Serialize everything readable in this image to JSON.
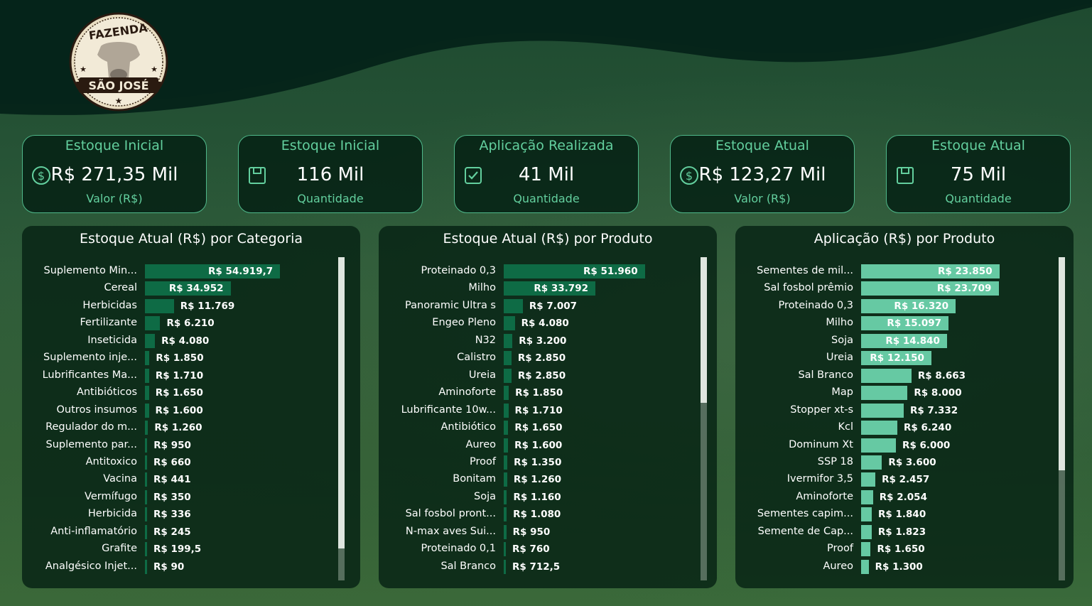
{
  "brand": {
    "logo_top": "FAZENDA",
    "logo_bottom": "SÃO JOSÉ"
  },
  "colors": {
    "bar_dark": "#0e6b45",
    "bar_light": "#66c9a3",
    "accent": "#63cf9e"
  },
  "kpis": [
    {
      "title": "Estoque Inicial",
      "value": "R$ 271,35 Mil",
      "subtitle": "Valor (R$)",
      "icon": "dollar-circle-icon"
    },
    {
      "title": "Estoque Inicial",
      "value": "116 Mil",
      "subtitle": "Quantidade",
      "icon": "save-box-icon"
    },
    {
      "title": "Aplicação Realizada",
      "value": "41 Mil",
      "subtitle": "Quantidade",
      "icon": "check-square-icon"
    },
    {
      "title": "Estoque Atual",
      "value": "R$ 123,27 Mil",
      "subtitle": "Valor (R$)",
      "icon": "dollar-circle-icon"
    },
    {
      "title": "Estoque Atual",
      "value": "75 Mil",
      "subtitle": "Quantidade",
      "icon": "save-box-icon"
    }
  ],
  "chart_data": [
    {
      "type": "bar",
      "orientation": "horizontal",
      "title": "Estoque Atual (R$) por Categoria",
      "color": "#0e6b45",
      "categories": [
        "Suplemento Min...",
        "Cereal",
        "Herbicidas",
        "Fertilizante",
        "Inseticida",
        "Suplemento inje...",
        "Lubrificantes Ma...",
        "Antibióticos",
        "Outros insumos",
        "Regulador do m...",
        "Suplemento par...",
        "Antitoxico",
        "Vacina",
        "Vermífugo",
        "Herbicida",
        "Anti-inflamatório",
        "Grafite",
        "Analgésico Injet..."
      ],
      "values": [
        54919.7,
        34952,
        11769,
        6210,
        4080,
        1850,
        1710,
        1650,
        1600,
        1260,
        950,
        660,
        441,
        350,
        336,
        245,
        199.5,
        90
      ],
      "labels": [
        "R$ 54.919,7",
        "R$ 34.952",
        "R$ 11.769",
        "R$ 6.210",
        "R$ 4.080",
        "R$ 1.850",
        "R$ 1.710",
        "R$ 1.650",
        "R$ 1.600",
        "R$ 1.260",
        "R$ 950",
        "R$ 660",
        "R$ 441",
        "R$ 350",
        "R$ 336",
        "R$ 245",
        "R$ 199,5",
        "R$ 90"
      ],
      "scroll_fraction": 0.9
    },
    {
      "type": "bar",
      "orientation": "horizontal",
      "title": "Estoque Atual (R$) por Produto",
      "color": "#0e6b45",
      "categories": [
        "Proteinado 0,3",
        "Milho",
        "Panoramic Ultra s",
        "Engeo Pleno",
        "N32",
        "Calistro",
        "Ureia",
        "Aminoforte",
        "Lubrificante 10w...",
        "Antibiótico",
        "Aureo",
        "Proof",
        "Bonitam",
        "Soja",
        "Sal fosbol pront...",
        "N-max aves Sui...",
        "Proteinado 0,1",
        "Sal Branco"
      ],
      "values": [
        51960,
        33792,
        7007,
        4080,
        3200,
        2850,
        2850,
        1850,
        1710,
        1650,
        1600,
        1350,
        1260,
        1160,
        1080,
        950,
        760,
        712.5
      ],
      "labels": [
        "R$ 51.960",
        "R$ 33.792",
        "R$ 7.007",
        "R$ 4.080",
        "R$ 3.200",
        "R$ 2.850",
        "R$ 2.850",
        "R$ 1.850",
        "R$ 1.710",
        "R$ 1.650",
        "R$ 1.600",
        "R$ 1.350",
        "R$ 1.260",
        "R$ 1.160",
        "R$ 1.080",
        "R$ 950",
        "R$ 760",
        "R$ 712,5"
      ],
      "scroll_fraction": 0.45
    },
    {
      "type": "bar",
      "orientation": "horizontal",
      "title": "Aplicação (R$) por Produto",
      "color": "#66c9a3",
      "categories": [
        "Sementes de mil...",
        "Sal fosbol prêmio",
        "Proteinado 0,3",
        "Milho",
        "Soja",
        "Ureia",
        "Sal Branco",
        "Map",
        "Stopper xt-s",
        "Kcl",
        "Dominum Xt",
        "SSP 18",
        "Ivermifor 3,5",
        "Aminoforte",
        "Sementes capim...",
        "Semente de Cap...",
        "Proof",
        "Aureo"
      ],
      "values": [
        23850,
        23709,
        16320,
        15097,
        14840,
        12150,
        8663,
        8000,
        7332,
        6240,
        6000,
        3600,
        2457,
        2054,
        1840,
        1823,
        1650,
        1300
      ],
      "labels": [
        "R$ 23.850",
        "R$ 23.709",
        "R$ 16.320",
        "R$ 15.097",
        "R$ 14.840",
        "R$ 12.150",
        "R$ 8.663",
        "R$ 8.000",
        "R$ 7.332",
        "R$ 6.240",
        "R$ 6.000",
        "R$ 3.600",
        "R$ 2.457",
        "R$ 2.054",
        "R$ 1.840",
        "R$ 1.823",
        "R$ 1.650",
        "R$ 1.300"
      ],
      "scroll_fraction": 0.66
    }
  ]
}
